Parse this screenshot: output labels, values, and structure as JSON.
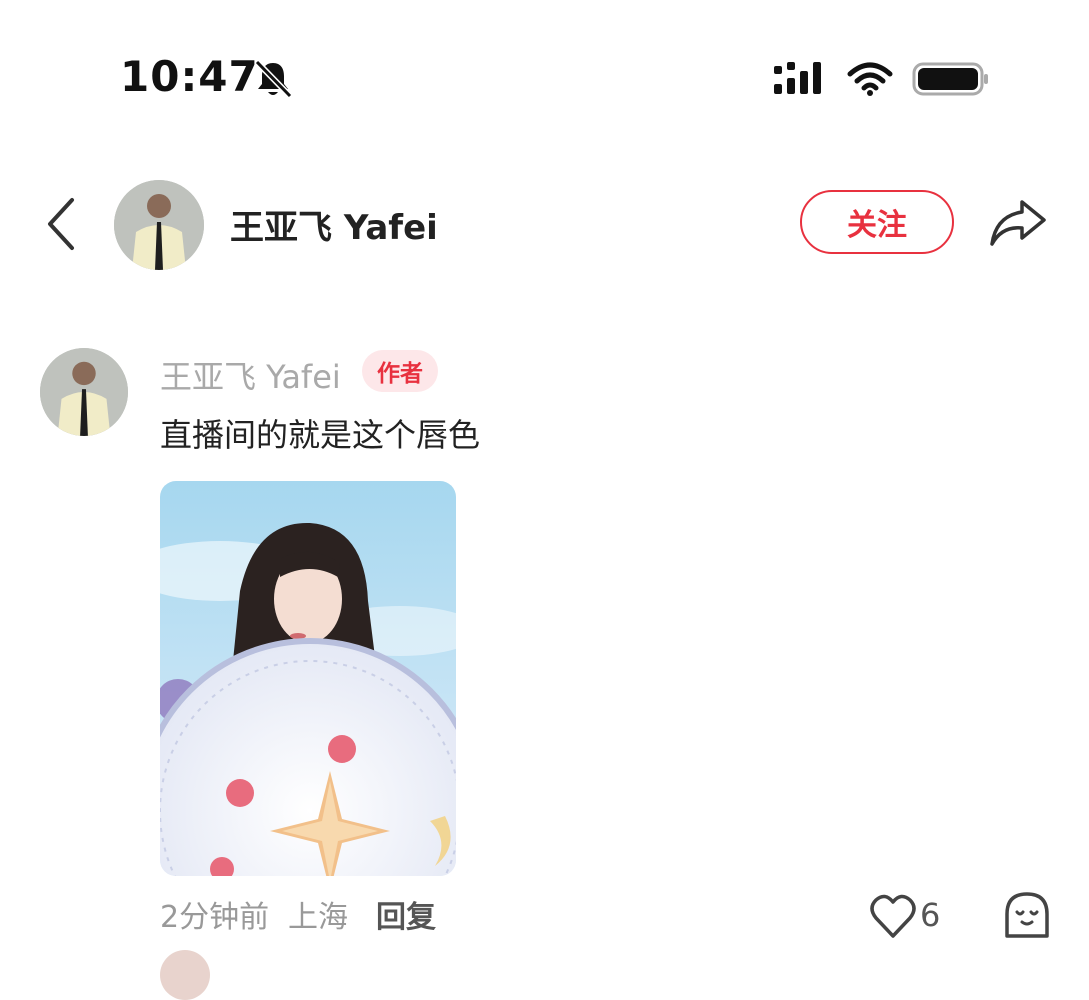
{
  "status_bar": {
    "time": "10:47",
    "icons": [
      "bell-muted-icon",
      "signal-icon",
      "wifi-icon",
      "battery-icon"
    ]
  },
  "header": {
    "back_icon": "chevron-left-icon",
    "user_name": "王亚飞 Yafei",
    "follow_label": "关注",
    "share_icon": "share-arrow-icon"
  },
  "comment": {
    "user_name": "王亚飞 Yafei",
    "author_badge": "作者",
    "text": "直播间的就是这个唇色",
    "time": "2分钟前",
    "location": "上海",
    "reply_label": "回复",
    "like_count": "6",
    "like_icon": "heart-outline-icon",
    "reaction_icon": "emoji-face-icon"
  },
  "colors": {
    "accent": "#e8313f",
    "badge_bg": "#fde7e9",
    "muted_text": "#a9a9a9"
  }
}
